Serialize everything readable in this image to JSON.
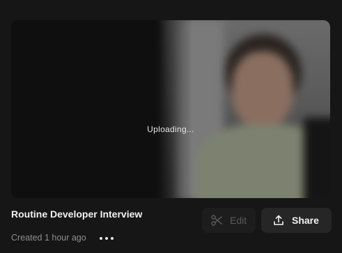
{
  "recording": {
    "status_text": "Uploading...",
    "title": "Routine Developer Interview",
    "created": "Created 1 hour ago"
  },
  "actions": {
    "edit_label": "Edit",
    "share_label": "Share"
  },
  "icons": {
    "edit": "scissors-icon",
    "share": "share-upload-icon",
    "more": "more-horizontal-icon"
  },
  "colors": {
    "background": "#161616",
    "edit_disabled_text": "#5a5a5a",
    "share_button_bg": "#262626"
  }
}
